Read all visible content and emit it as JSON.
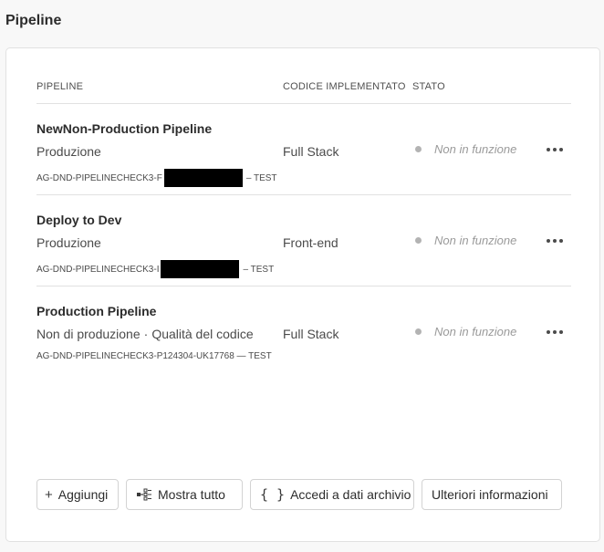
{
  "page": {
    "title": "Pipeline"
  },
  "table": {
    "headers": {
      "pipeline": "PIPELINE",
      "code": "CODICE IMPLEMENTATO",
      "status": "STATO"
    },
    "rows": [
      {
        "name": "NewNon-Production Pipeline",
        "env": "Produzione",
        "env_extra": "",
        "id_prefix": "AG-DND-PIPELINECHECK3-F",
        "id_suffix": "– TEST",
        "code": "Full Stack",
        "status": "Non in funzione",
        "status_icon": "status-dot-icon",
        "more_icon": "more-icon"
      },
      {
        "name": "Deploy to Dev",
        "env": "Produzione",
        "env_extra": "",
        "id_prefix": "AG-DND-PIPELINECHECK3-I",
        "id_suffix": "– TEST",
        "code": "Front-end",
        "status": "Non in funzione",
        "status_icon": "status-dot-icon",
        "more_icon": "more-icon"
      },
      {
        "name": "Production Pipeline",
        "env": "Non di produzione",
        "env_sep": "·",
        "env_extra": "Qualità del codice",
        "id": "AG-DND-PIPELINECHECK3-P124304-UK17768 — TEST",
        "code": "Full Stack",
        "status": "Non in funzione",
        "status_icon": "status-dot-icon",
        "more_icon": "more-icon"
      }
    ]
  },
  "actions": {
    "add": {
      "label": "Aggiungi",
      "icon": "plus-icon"
    },
    "show_all": {
      "label": "Mostra tutto",
      "icon": "pipeline-list-icon"
    },
    "archive": {
      "label": "Accedi a dati archivio",
      "icon": "braces-icon"
    },
    "more_info": {
      "label": "Ulteriori informazioni"
    }
  }
}
